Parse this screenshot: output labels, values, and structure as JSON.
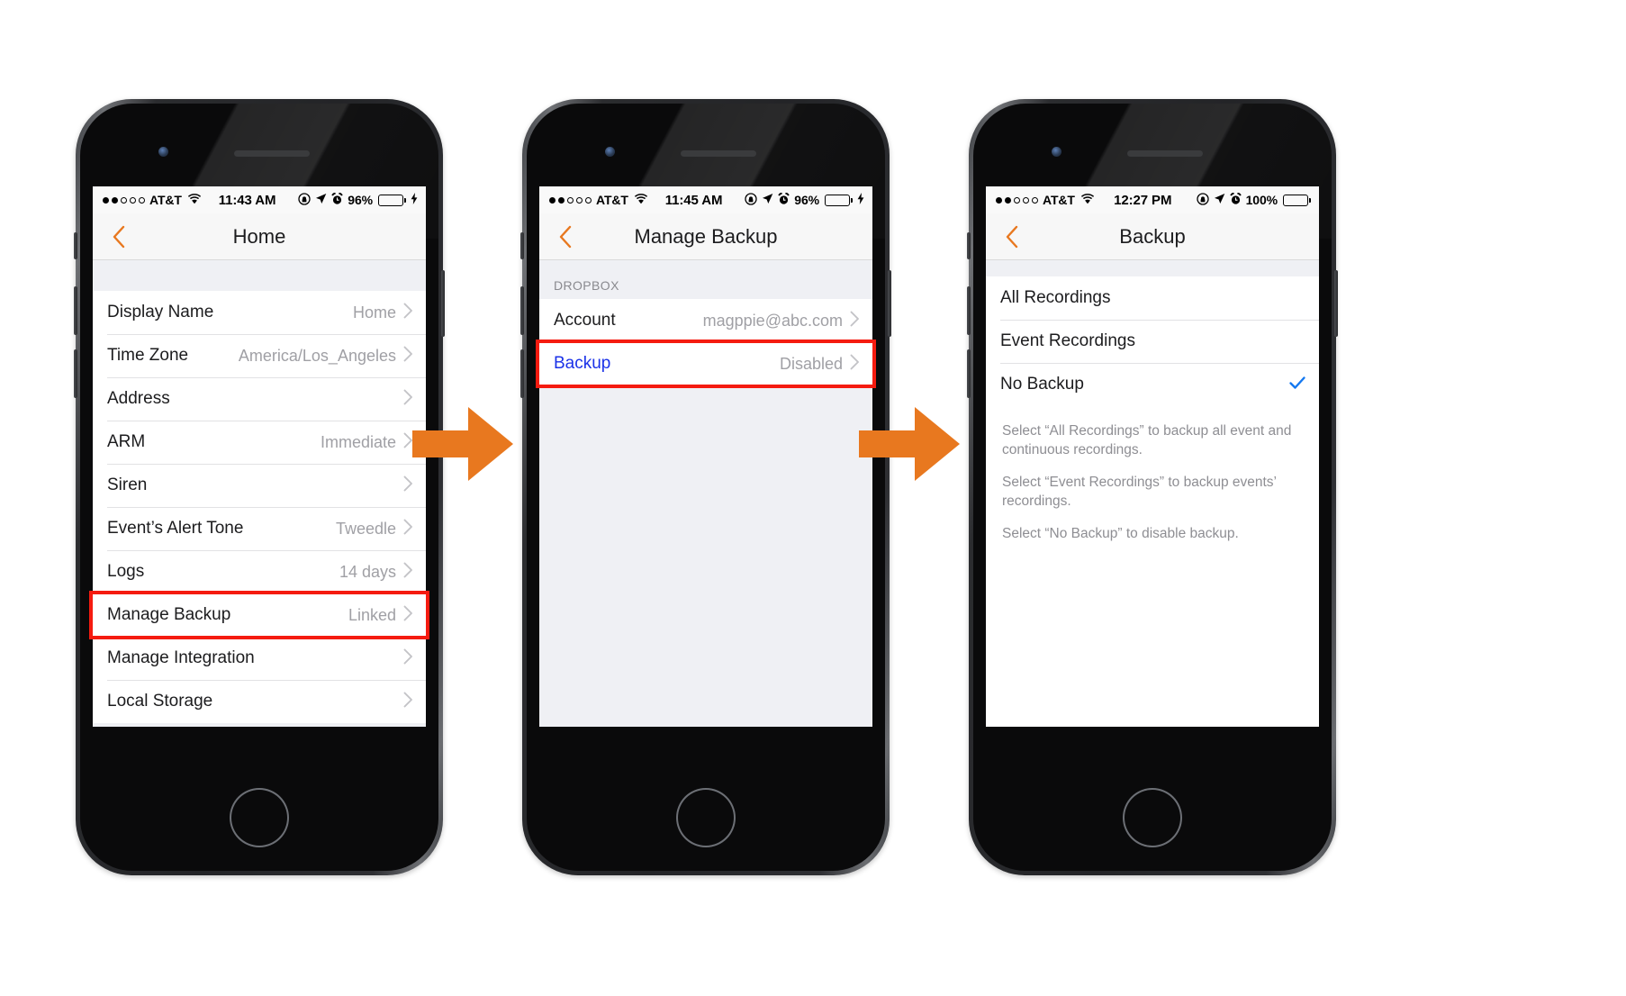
{
  "accent": {
    "arrow_orange": "#E8781F",
    "highlight_red": "#F51B10",
    "ios_blue": "#1B32E8",
    "check_blue": "#1478F0",
    "battery_green": "#4CD964"
  },
  "phones": [
    {
      "id": "phone-home-settings",
      "status": {
        "signal_dots_filled": 2,
        "signal_dots_total": 5,
        "carrier": "AT&T",
        "wifi_icon": "wifi-icon",
        "time": "11:43 AM",
        "icons": [
          "rotation-lock-icon",
          "location-arrow-icon",
          "alarm-clock-icon"
        ],
        "battery_percent": "96%",
        "battery_fill": 82,
        "battery_color": "#4CD964",
        "charging": true
      },
      "nav": {
        "back_icon": "back-chevron-icon",
        "title": "Home"
      },
      "rows": [
        {
          "label": "Display Name",
          "value": "Home",
          "chevron": true,
          "highlighted": false
        },
        {
          "label": "Time Zone",
          "value": "America/Los_Angeles",
          "chevron": true,
          "highlighted": false
        },
        {
          "label": "Address",
          "value": "",
          "chevron": true,
          "highlighted": false
        },
        {
          "label": "ARM",
          "value": "Immediate",
          "chevron": true,
          "highlighted": false
        },
        {
          "label": "Siren",
          "value": "",
          "chevron": true,
          "highlighted": false
        },
        {
          "label": "Event’s Alert Tone",
          "value": "Tweedle",
          "chevron": true,
          "highlighted": false
        },
        {
          "label": "Logs",
          "value": "14 days",
          "chevron": true,
          "highlighted": false
        },
        {
          "label": "Manage Backup",
          "value": "Linked",
          "chevron": true,
          "highlighted": true
        },
        {
          "label": "Manage Integration",
          "value": "",
          "chevron": true,
          "highlighted": false
        },
        {
          "label": "Local Storage",
          "value": "",
          "chevron": true,
          "highlighted": false
        }
      ],
      "footer_notes": []
    },
    {
      "id": "phone-manage-backup",
      "status": {
        "signal_dots_filled": 2,
        "signal_dots_total": 5,
        "carrier": "AT&T",
        "wifi_icon": "wifi-icon",
        "time": "11:45 AM",
        "icons": [
          "rotation-lock-icon",
          "location-arrow-icon",
          "alarm-clock-icon"
        ],
        "battery_percent": "96%",
        "battery_fill": 82,
        "battery_color": "#4CD964",
        "charging": true
      },
      "nav": {
        "back_icon": "back-chevron-icon",
        "title": "Manage Backup"
      },
      "section_header": "DROPBOX",
      "rows": [
        {
          "label": "Account",
          "value": "magppie@abc.com",
          "chevron": true,
          "highlighted": false
        },
        {
          "label": "Backup",
          "value": "Disabled",
          "chevron": true,
          "highlighted": true,
          "label_blue": true
        }
      ],
      "footer_notes": []
    },
    {
      "id": "phone-backup-options",
      "status": {
        "signal_dots_filled": 2,
        "signal_dots_total": 5,
        "carrier": "AT&T",
        "wifi_icon": "wifi-icon",
        "time": "12:27 PM",
        "icons": [
          "rotation-lock-icon",
          "location-arrow-icon",
          "alarm-clock-icon"
        ],
        "battery_percent": "100%",
        "battery_fill": 100,
        "battery_color": "#000000",
        "charging": false
      },
      "nav": {
        "back_icon": "back-chevron-icon",
        "title": "Backup"
      },
      "rows": [
        {
          "label": "All Recordings",
          "value": "",
          "chevron": false,
          "checked": false,
          "highlighted": false
        },
        {
          "label": "Event Recordings",
          "value": "",
          "chevron": false,
          "checked": false,
          "highlighted": false
        },
        {
          "label": "No Backup",
          "value": "",
          "chevron": false,
          "checked": true,
          "highlighted": false
        }
      ],
      "footer_notes": [
        "Select “All Recordings” to backup all event and continuous recordings.",
        "Select “Event Recordings” to backup events’ recordings.",
        "Select “No Backup” to disable backup."
      ]
    }
  ],
  "arrows": [
    {
      "name": "step-arrow-1",
      "direction": "right"
    },
    {
      "name": "step-arrow-2",
      "direction": "right"
    }
  ]
}
